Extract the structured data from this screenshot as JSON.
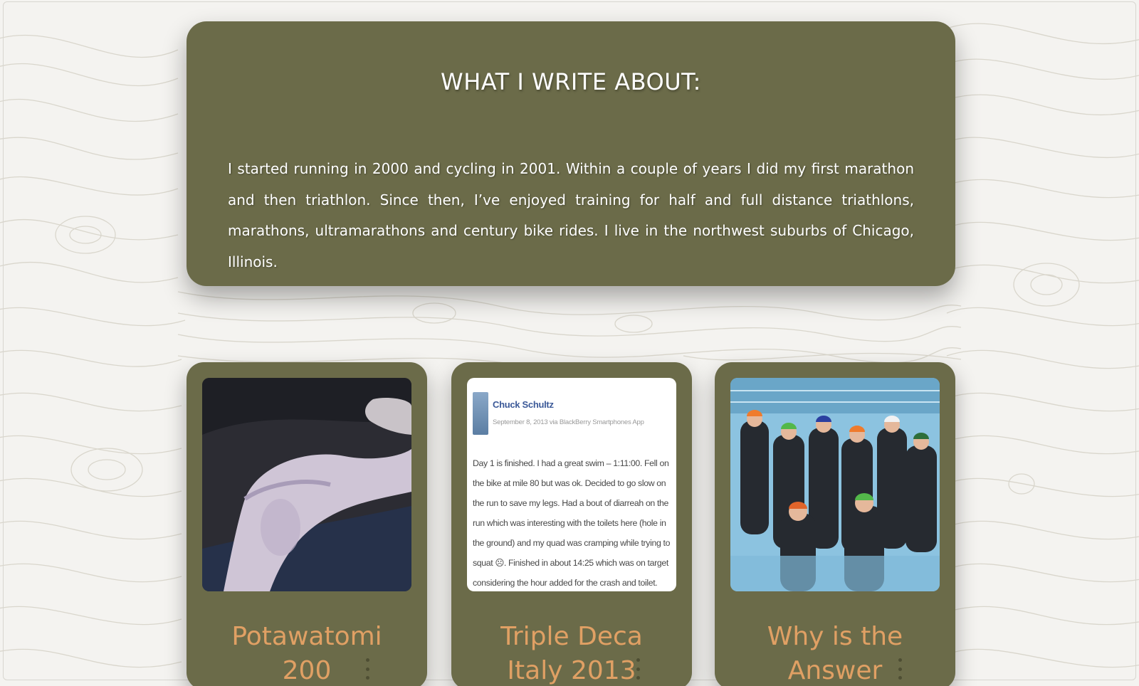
{
  "about": {
    "title": "WHAT I WRITE ABOUT:",
    "text": "I started running in 2000 and cycling in 2001. Within a couple of years I did my first marathon and then triathlon. Since then, I’ve enjoyed training for half and full distance triathlons, marathons, ultramarathons and century bike rides. I live in the northwest suburbs of Chicago, Illinois."
  },
  "posts": [
    {
      "title": "Potawatomi 200",
      "image": "injured-ankle-photo",
      "menu_icon": "more-vertical-icon"
    },
    {
      "title": "Triple Deca Italy 2013",
      "image": "facebook-post-screenshot",
      "menu_icon": "more-vertical-icon",
      "fb": {
        "author": "Chuck Schultz",
        "meta": "September 8, 2013 via BlackBerry Smartphones App",
        "body": "Day 1 is finished. I had a great swim – 1:11:00. Fell on the bike at mile 80 but was ok. Decided to go slow on the run to save my legs. Had a bout of diarreah on the run which was interesting with the toilets here (hole in the ground) and my quad was cramping while trying to squat ☹. Finished in about 14:25 which was on target considering the hour added for the crash and toilet."
      }
    },
    {
      "title": "Why is the Answer",
      "image": "swimmers-in-pool-photo",
      "menu_icon": "more-vertical-icon"
    }
  ],
  "colors": {
    "card_bg": "#6b6b49",
    "title_accent": "#e0a064",
    "page_bg": "#f4f3f0",
    "topo_lines": "#d9d6cc"
  }
}
